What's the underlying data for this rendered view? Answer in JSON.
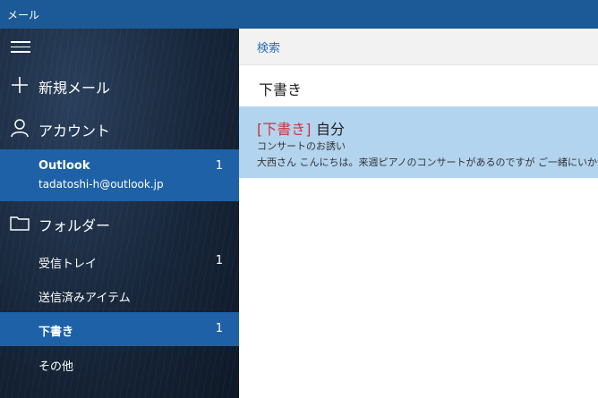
{
  "window": {
    "title": "メール"
  },
  "sidebar": {
    "new_mail": "新規メール",
    "account_label": "アカウント",
    "account": {
      "name": "Outlook",
      "email": "tadatoshi-h@outlook.jp",
      "unread": "1"
    },
    "folder_label": "フォルダー",
    "folders": [
      {
        "label": "受信トレイ",
        "count": "1"
      },
      {
        "label": "送信済みアイテム",
        "count": ""
      },
      {
        "label": "下書き",
        "count": "1"
      },
      {
        "label": "その他",
        "count": ""
      }
    ]
  },
  "main": {
    "search_label": "検索",
    "folder_title": "下書き",
    "messages": [
      {
        "tag": "[下書き]",
        "sender": "自分",
        "subject": "コンサートのお誘い",
        "preview": "大西さん こんにちは。来週ピアノのコンサートがあるのですが ご一緒にいかがですか"
      }
    ]
  },
  "colors": {
    "titlebar": "#1b5a96",
    "selection": "#1e61a6",
    "message_highlight": "#b3d4ee",
    "draft_tag": "#d13438"
  }
}
